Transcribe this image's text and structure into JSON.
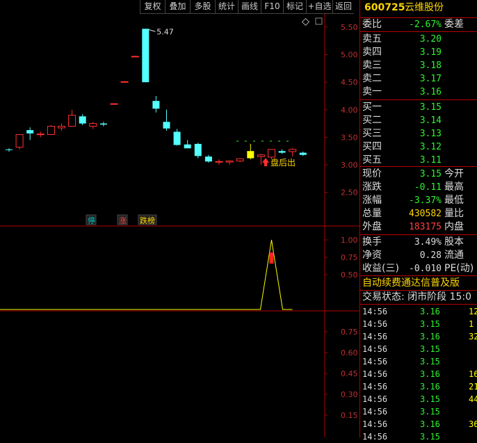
{
  "toolbar": {
    "buttons": [
      "复权",
      "叠加",
      "多股",
      "统计",
      "画线",
      "F10",
      "标记",
      "+自选",
      "返回"
    ]
  },
  "chart": {
    "price_axis": [
      "5.50",
      "5.00",
      "4.50",
      "4.00",
      "3.50",
      "3.00",
      "2.50"
    ],
    "high_label": "5.47",
    "after_hours_label": "盘后出",
    "markers": [
      {
        "text": "停",
        "color": "#00c0c0"
      },
      {
        "text": "涨",
        "color": "#ff4040"
      },
      {
        "text": "跌榜",
        "color": "#ffd700"
      }
    ],
    "indicator1_axis": [
      "1.00",
      "0.75",
      "0.50"
    ],
    "indicator2_axis": [
      "0.75",
      "0.60",
      "0.45",
      "0.30",
      "0.15"
    ],
    "colors": {
      "up": "#ff3030",
      "down": "#54ffff",
      "grid": "#b00000",
      "axis_text": "#c03030",
      "highlight": "#ffff00"
    }
  },
  "chart_data": {
    "type": "candlestick",
    "ylim": [
      2.2,
      5.7
    ],
    "candles": [
      {
        "o": 3.28,
        "h": 3.3,
        "l": 3.24,
        "c": 3.27
      },
      {
        "o": 3.32,
        "h": 3.55,
        "l": 3.28,
        "c": 3.55
      },
      {
        "o": 3.63,
        "h": 3.68,
        "l": 3.45,
        "c": 3.57
      },
      {
        "o": 3.56,
        "h": 3.6,
        "l": 3.5,
        "c": 3.56
      },
      {
        "o": 3.55,
        "h": 3.72,
        "l": 3.54,
        "c": 3.7
      },
      {
        "o": 3.67,
        "h": 3.75,
        "l": 3.62,
        "c": 3.7
      },
      {
        "o": 3.7,
        "h": 4.0,
        "l": 3.69,
        "c": 3.9
      },
      {
        "o": 3.88,
        "h": 3.92,
        "l": 3.72,
        "c": 3.75
      },
      {
        "o": 3.7,
        "h": 3.78,
        "l": 3.65,
        "c": 3.75
      },
      {
        "o": 3.75,
        "h": 3.78,
        "l": 3.7,
        "c": 3.73
      },
      {
        "o": 4.1,
        "h": 4.12,
        "l": 4.09,
        "c": 4.11
      },
      {
        "o": 4.5,
        "h": 4.52,
        "l": 4.49,
        "c": 4.51
      },
      {
        "o": 4.96,
        "h": 4.98,
        "l": 4.95,
        "c": 4.97
      },
      {
        "o": 5.47,
        "h": 5.47,
        "l": 4.5,
        "c": 4.5
      },
      {
        "o": 4.16,
        "h": 4.25,
        "l": 3.95,
        "c": 4.02
      },
      {
        "o": 3.78,
        "h": 4.0,
        "l": 3.62,
        "c": 3.66
      },
      {
        "o": 3.6,
        "h": 3.65,
        "l": 3.35,
        "c": 3.36
      },
      {
        "o": 3.37,
        "h": 3.45,
        "l": 3.3,
        "c": 3.3
      },
      {
        "o": 3.38,
        "h": 3.4,
        "l": 3.12,
        "c": 3.16
      },
      {
        "o": 3.15,
        "h": 3.18,
        "l": 3.04,
        "c": 3.06
      },
      {
        "o": 3.05,
        "h": 3.1,
        "l": 3.0,
        "c": 3.06
      },
      {
        "o": 3.05,
        "h": 3.08,
        "l": 3.0,
        "c": 3.07
      },
      {
        "o": 3.07,
        "h": 3.12,
        "l": 3.05,
        "c": 3.11
      },
      {
        "o": 3.12,
        "h": 3.38,
        "l": 3.1,
        "c": 3.25
      },
      {
        "o": 3.15,
        "h": 3.2,
        "l": 3.0,
        "c": 3.18
      },
      {
        "o": 3.14,
        "h": 3.28,
        "l": 3.1,
        "c": 3.28
      },
      {
        "o": 3.25,
        "h": 3.28,
        "l": 3.2,
        "c": 3.22
      },
      {
        "o": 3.24,
        "h": 3.3,
        "l": 3.15,
        "c": 3.28
      },
      {
        "o": 3.22,
        "h": 3.24,
        "l": 3.16,
        "c": 3.18
      }
    ],
    "indicator1": {
      "ylim": [
        0,
        1.25
      ],
      "peak_index": 25,
      "peak_value": 1.0
    }
  },
  "panel": {
    "code": "600725",
    "name": "云维股份",
    "webi": {
      "label": "委比",
      "value": "-2.67%",
      "label2": "委差"
    },
    "sells": [
      {
        "label": "卖五",
        "price": "3.20"
      },
      {
        "label": "卖四",
        "price": "3.19"
      },
      {
        "label": "卖三",
        "price": "3.18"
      },
      {
        "label": "卖二",
        "price": "3.17"
      },
      {
        "label": "卖一",
        "price": "3.16"
      }
    ],
    "buys": [
      {
        "label": "买一",
        "price": "3.15"
      },
      {
        "label": "买二",
        "price": "3.14"
      },
      {
        "label": "买三",
        "price": "3.13"
      },
      {
        "label": "买四",
        "price": "3.12"
      },
      {
        "label": "买五",
        "price": "3.11"
      }
    ],
    "quote": [
      {
        "label": "现价",
        "value": "3.15",
        "label2": "今开",
        "cls": "green"
      },
      {
        "label": "涨跌",
        "value": "-0.11",
        "label2": "最高",
        "cls": "green"
      },
      {
        "label": "涨幅",
        "value": "-3.37%",
        "label2": "最低",
        "cls": "green"
      },
      {
        "label": "总量",
        "value": "430582",
        "label2": "量比",
        "cls": "yellow"
      },
      {
        "label": "外盘",
        "value": "183175",
        "label2": "内盘",
        "cls": "red"
      }
    ],
    "fin": [
      {
        "label": "换手",
        "value": "3.49%",
        "label2": "股本"
      },
      {
        "label": "净资",
        "value": "0.28",
        "label2": "流通"
      },
      {
        "label": "收益(三)",
        "value": "-0.010",
        "label2": "PE(动)"
      }
    ],
    "notice": "自动续费通达信普及版",
    "status": "交易状态: 闭市阶段 15:0",
    "ticks": [
      {
        "time": "14:56",
        "price": "3.16",
        "vol": "12",
        "cls": "green"
      },
      {
        "time": "14:56",
        "price": "3.15",
        "vol": "1",
        "cls": "green"
      },
      {
        "time": "14:56",
        "price": "3.16",
        "vol": "32",
        "cls": "green"
      },
      {
        "time": "14:56",
        "price": "3.15",
        "vol": "",
        "cls": "green"
      },
      {
        "time": "14:56",
        "price": "3.15",
        "vol": "",
        "cls": "green"
      },
      {
        "time": "14:56",
        "price": "3.16",
        "vol": "16",
        "cls": "green"
      },
      {
        "time": "14:56",
        "price": "3.16",
        "vol": "21",
        "cls": "green"
      },
      {
        "time": "14:56",
        "price": "3.15",
        "vol": "44",
        "cls": "green"
      },
      {
        "time": "14:56",
        "price": "3.15",
        "vol": "",
        "cls": "green"
      },
      {
        "time": "14:56",
        "price": "3.16",
        "vol": "36",
        "cls": "green"
      },
      {
        "time": "14:56",
        "price": "3.15",
        "vol": "",
        "cls": "green"
      }
    ]
  }
}
